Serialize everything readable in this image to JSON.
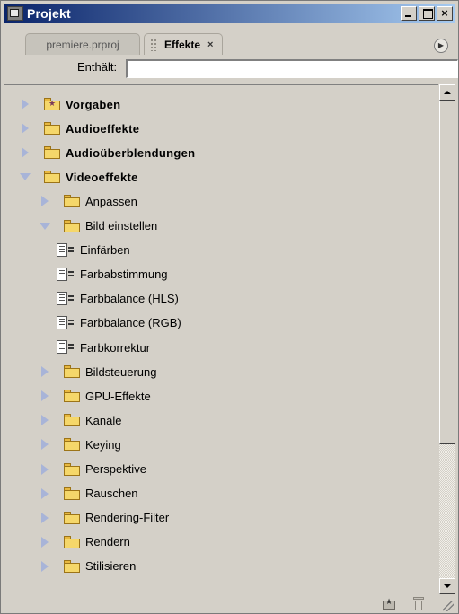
{
  "window": {
    "title": "Projekt",
    "buttons": {
      "minimize": "_",
      "maximize": "□",
      "close": "×"
    }
  },
  "tabs": [
    {
      "label": "premiere.prproj",
      "active": false
    },
    {
      "label": "Effekte",
      "active": true,
      "close": "×"
    }
  ],
  "search": {
    "label": "Enthält:",
    "value": ""
  },
  "tree": [
    {
      "label": "Vorgaben",
      "kind": "star-folder",
      "state": "closed",
      "level": 0,
      "bold": true
    },
    {
      "label": "Audioeffekte",
      "kind": "folder",
      "state": "closed",
      "level": 0,
      "bold": true
    },
    {
      "label": "Audioüberblendungen",
      "kind": "folder",
      "state": "closed",
      "level": 0,
      "bold": true
    },
    {
      "label": "Videoeffekte",
      "kind": "folder",
      "state": "open",
      "level": 0,
      "bold": true
    },
    {
      "label": "Anpassen",
      "kind": "folder",
      "state": "closed",
      "level": 1,
      "bold": false
    },
    {
      "label": "Bild einstellen",
      "kind": "folder",
      "state": "open",
      "level": 1,
      "bold": false
    },
    {
      "label": "Einfärben",
      "kind": "effect",
      "level": 2,
      "bold": false
    },
    {
      "label": "Farbabstimmung",
      "kind": "effect",
      "level": 2,
      "bold": false
    },
    {
      "label": "Farbbalance (HLS)",
      "kind": "effect",
      "level": 2,
      "bold": false
    },
    {
      "label": "Farbbalance (RGB)",
      "kind": "effect",
      "level": 2,
      "bold": false
    },
    {
      "label": "Farbkorrektur",
      "kind": "effect",
      "level": 2,
      "bold": false
    },
    {
      "label": "Bildsteuerung",
      "kind": "folder",
      "state": "closed",
      "level": 1,
      "bold": false
    },
    {
      "label": "GPU-Effekte",
      "kind": "folder",
      "state": "closed",
      "level": 1,
      "bold": false
    },
    {
      "label": "Kanäle",
      "kind": "folder",
      "state": "closed",
      "level": 1,
      "bold": false
    },
    {
      "label": "Keying",
      "kind": "folder",
      "state": "closed",
      "level": 1,
      "bold": false
    },
    {
      "label": "Perspektive",
      "kind": "folder",
      "state": "closed",
      "level": 1,
      "bold": false
    },
    {
      "label": "Rauschen",
      "kind": "folder",
      "state": "closed",
      "level": 1,
      "bold": false
    },
    {
      "label": "Rendering-Filter",
      "kind": "folder",
      "state": "closed",
      "level": 1,
      "bold": false
    },
    {
      "label": "Rendern",
      "kind": "folder",
      "state": "closed",
      "level": 1,
      "bold": false
    },
    {
      "label": "Stilisieren",
      "kind": "folder",
      "state": "closed",
      "level": 1,
      "bold": false
    }
  ],
  "scrollbar": {
    "position_fraction": 0.0,
    "visible_fraction": 0.72
  },
  "colors": {
    "titlebar_start": "#0a246a",
    "titlebar_end": "#a6caf0",
    "panel": "#d4d0c8",
    "folder": "#f5d76a",
    "disclosure": "#a8b4d8"
  },
  "icons": {
    "app": "premiere-app-icon",
    "new_bin": "new-bin-icon",
    "trash": "trash-icon",
    "flyout": "panel-menu-icon",
    "resize": "resize-grip-icon"
  }
}
